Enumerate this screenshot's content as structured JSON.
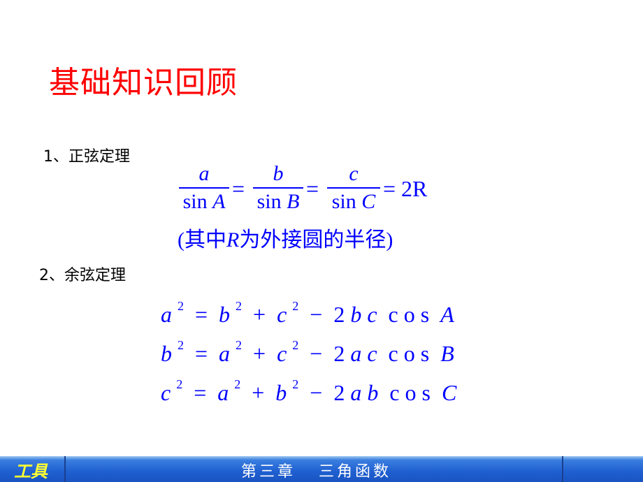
{
  "slide": {
    "title": "基础知识回顾",
    "section1": "1、正弦定理",
    "sine_law": {
      "fractions": [
        {
          "num": "a",
          "den_fn": "sin",
          "den_var": "A"
        },
        {
          "num": "b",
          "den_fn": "sin",
          "den_var": "B"
        },
        {
          "num": "c",
          "den_fn": "sin",
          "den_var": "C"
        }
      ],
      "equals": "=",
      "result": "= 2R",
      "note_prefix": "(其中",
      "note_var": "R",
      "note_suffix": "为外接圆的半径)"
    },
    "section2": "2、余弦定理",
    "cosine_law": [
      {
        "lhs": "a",
        "t1": "b",
        "t2": "c",
        "prod": "b c",
        "angle": "A"
      },
      {
        "lhs": "b",
        "t1": "a",
        "t2": "c",
        "prod": "a c",
        "angle": "B"
      },
      {
        "lhs": "c",
        "t1": "a",
        "t2": "b",
        "prod": "a b",
        "angle": "C"
      }
    ],
    "exp": "2",
    "cos_label": "c o s"
  },
  "footer": {
    "tools_label": "工具",
    "chapter_label": "第三章   三角函数"
  }
}
